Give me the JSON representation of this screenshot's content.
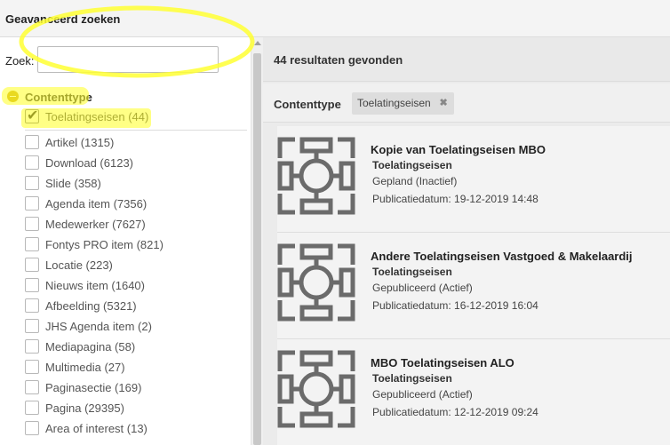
{
  "window": {
    "title": "Geavanceerd zoeken"
  },
  "search": {
    "label": "Zoek:",
    "value": "",
    "placeholder": ""
  },
  "facet": {
    "title": "Contenttype",
    "selected": {
      "label": "Toelatingseisen (44)",
      "checked": true
    },
    "items": [
      {
        "label": "Artikel (1315)"
      },
      {
        "label": "Download (6123)"
      },
      {
        "label": "Slide (358)"
      },
      {
        "label": "Agenda item (7356)"
      },
      {
        "label": "Medewerker (7627)"
      },
      {
        "label": "Fontys PRO item (821)"
      },
      {
        "label": "Locatie (223)"
      },
      {
        "label": "Nieuws item (1640)"
      },
      {
        "label": "Afbeelding (5321)"
      },
      {
        "label": "JHS Agenda item (2)"
      },
      {
        "label": "Mediapagina (58)"
      },
      {
        "label": "Multimedia (27)"
      },
      {
        "label": "Paginasectie (169)"
      },
      {
        "label": "Pagina (29395)"
      },
      {
        "label": "Area of interest (13)"
      }
    ]
  },
  "results": {
    "count_label": "44 resultaten gevonden",
    "filter_label": "Contenttype",
    "active_filter": "Toelatingseisen",
    "remove_icon": "✖",
    "items": [
      {
        "title": "Kopie van Toelatingseisen MBO",
        "type": "Toelatingseisen",
        "status": "Gepland (Inactief)",
        "date": "Publicatiedatum: 19-12-2019 14:48"
      },
      {
        "title": "Andere Toelatingseisen Vastgoed & Makelaardij",
        "type": "Toelatingseisen",
        "status": "Gepubliceerd (Actief)",
        "date": "Publicatiedatum: 16-12-2019 16:04"
      },
      {
        "title": "MBO Toelatingseisen ALO",
        "type": "Toelatingseisen",
        "status": "Gepubliceerd (Actief)",
        "date": "Publicatiedatum: 12-12-2019 09:24"
      }
    ]
  },
  "colors": {
    "highlight": "#ffff33",
    "icon_gray": "#6b6b6b",
    "collapse_icon": "#c8a000"
  }
}
